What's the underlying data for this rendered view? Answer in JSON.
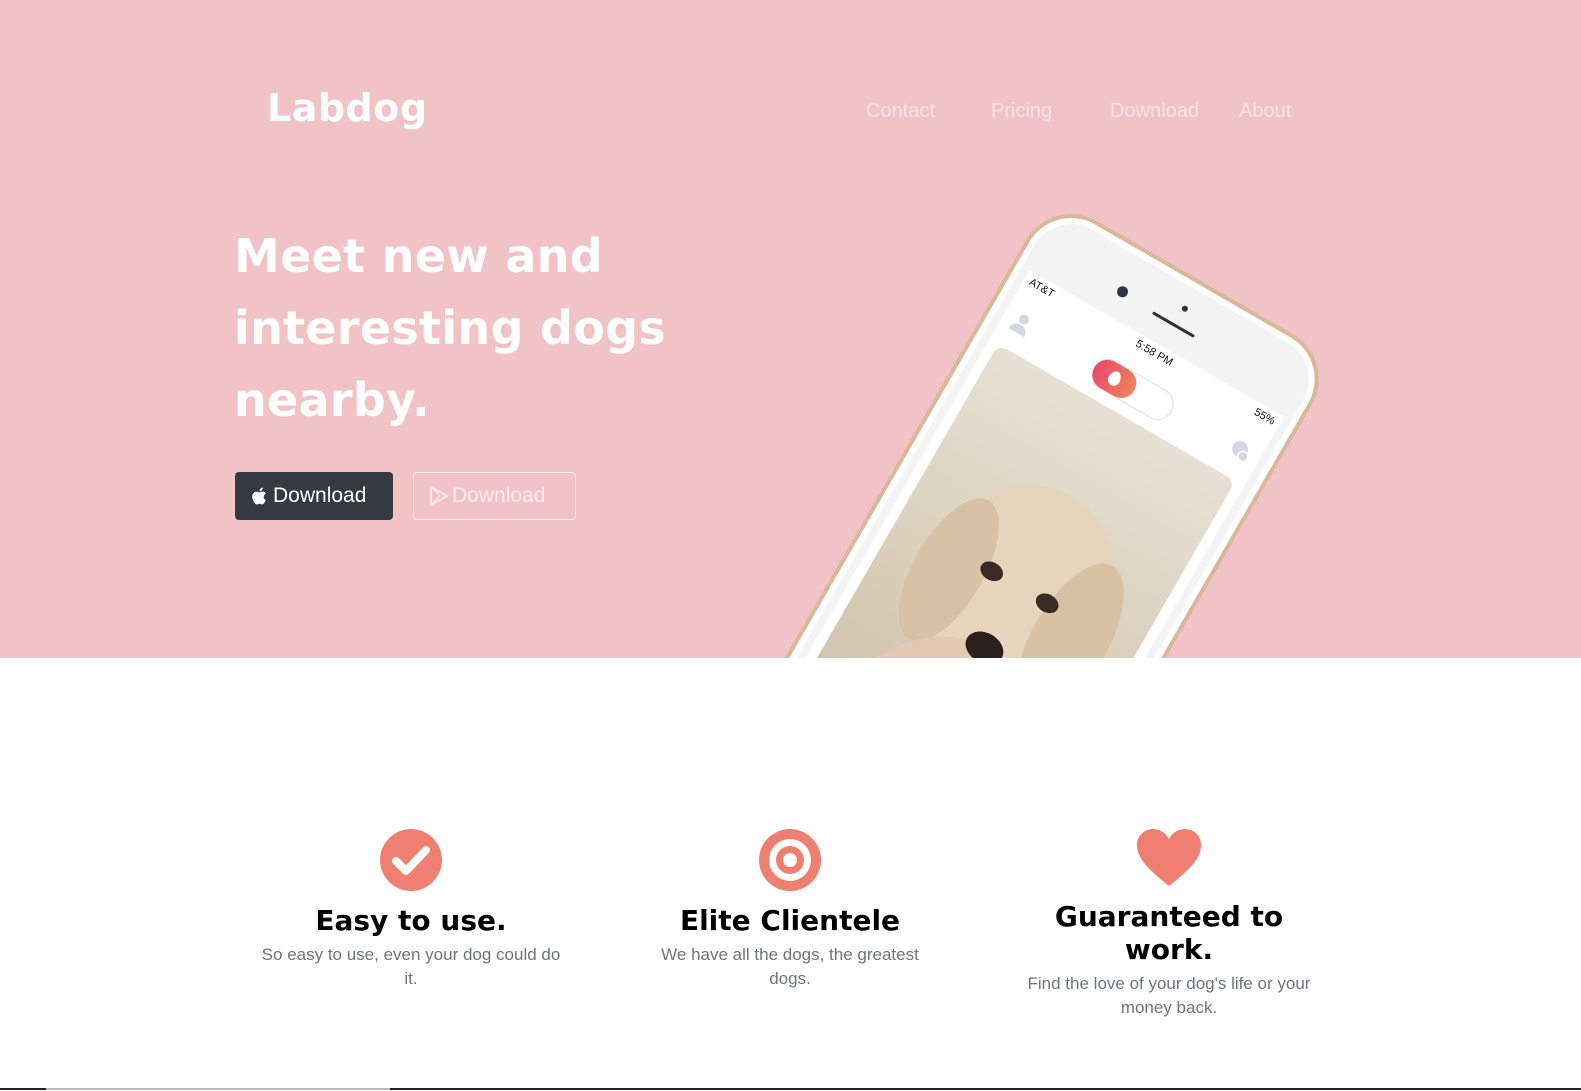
{
  "brand": {
    "name": "Labdog"
  },
  "nav": {
    "items": [
      {
        "label": "Contact"
      },
      {
        "label": "Pricing"
      },
      {
        "label": "Download"
      },
      {
        "label": "About"
      }
    ]
  },
  "hero": {
    "headline": "Meet new and interesting dogs nearby.",
    "buttons": {
      "ios": {
        "label": "Download",
        "icon": "apple-icon"
      },
      "android": {
        "label": "Download",
        "icon": "play-store-icon"
      }
    },
    "phone": {
      "carrier": "AT&T",
      "time": "5:58 PM",
      "battery": "55%"
    }
  },
  "features": [
    {
      "title": "Easy to use.",
      "text": "So easy to use, even your dog could do it.",
      "icon": "checkmark-circle-icon"
    },
    {
      "title": "Elite Clientele",
      "text": "We have all the dogs, the greatest dogs.",
      "icon": "target-icon"
    },
    {
      "title": "Guaranteed to work.",
      "text": "Find the love of your dog's life or your money back.",
      "icon": "heart-icon"
    }
  ],
  "colors": {
    "hero_bg": "#f1c3c6",
    "accent": "#ef7f70",
    "dark_button": "#343a40"
  }
}
